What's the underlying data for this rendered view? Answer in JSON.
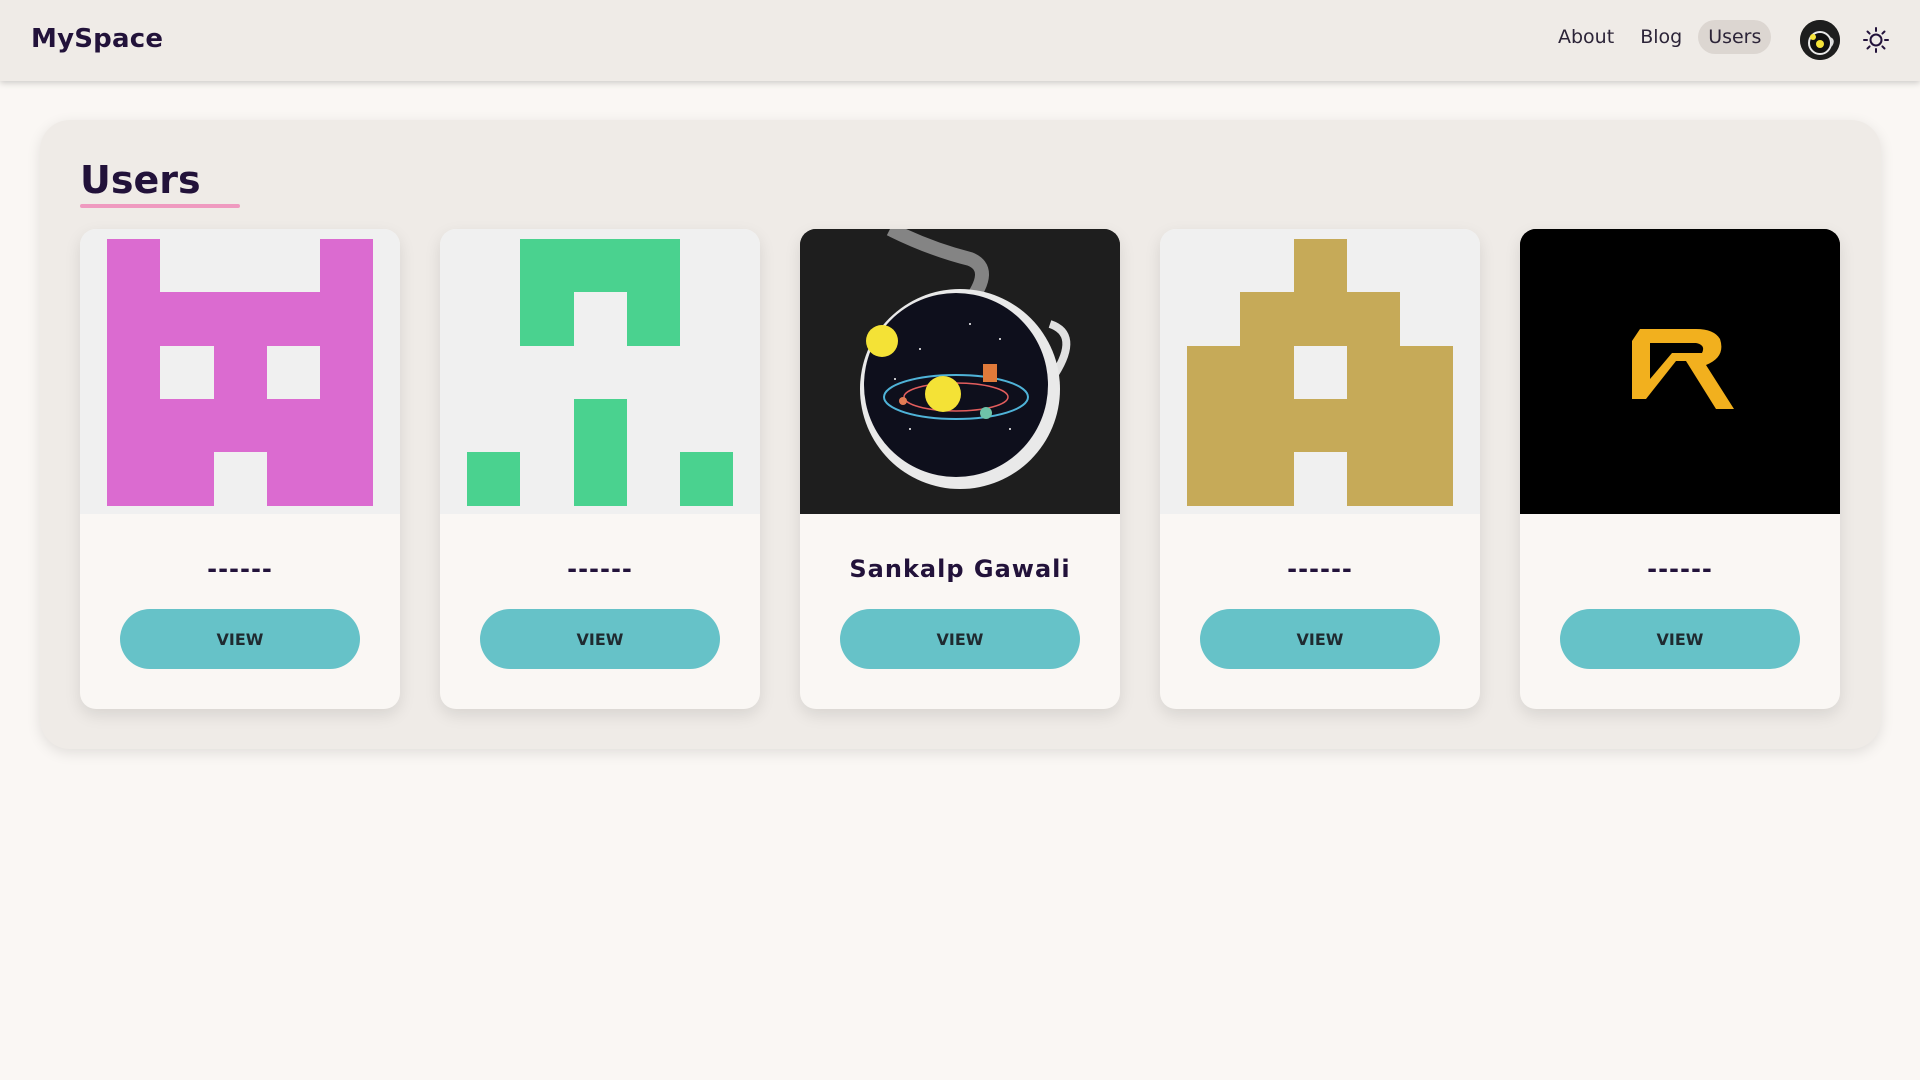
{
  "header": {
    "brand": "MySpace",
    "nav": [
      {
        "label": "About",
        "active": false
      },
      {
        "label": "Blog",
        "active": false
      },
      {
        "label": "Users",
        "active": true
      }
    ],
    "avatar_icon": "tea-cup-galaxy-avatar",
    "theme_icon": "sun-icon"
  },
  "main": {
    "title": "Users",
    "accent_color": "#ef9ac0",
    "button_color": "#66c2c8",
    "users": [
      {
        "name": "------",
        "image": "pink-identicon",
        "color": "#db6bd0",
        "button": "VIEW"
      },
      {
        "name": "------",
        "image": "green-identicon",
        "color": "#4ad28f",
        "button": "VIEW"
      },
      {
        "name": "Sankalp Gawali",
        "image": "tea-cup-galaxy",
        "color": "#1e1e1e",
        "button": "VIEW"
      },
      {
        "name": "------",
        "image": "gold-identicon",
        "color": "#c6aa58",
        "button": "VIEW"
      },
      {
        "name": "------",
        "image": "r-logo",
        "color": "#f2b01e",
        "button": "VIEW"
      }
    ]
  }
}
